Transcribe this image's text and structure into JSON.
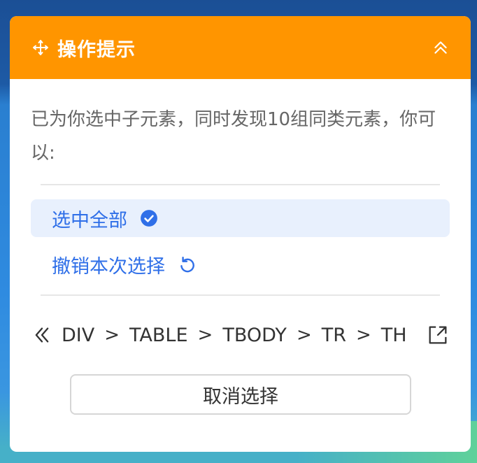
{
  "colors": {
    "accent": "#ff9500",
    "link": "#2f6fe8",
    "selected_bg": "#e8f0fd"
  },
  "header": {
    "title": "操作提示",
    "move_icon": "move-icon",
    "collapse_icon": "chevron-double-up-icon"
  },
  "tip": {
    "text": "已为你选中子元素，同时发现10组同类元素，你可以:"
  },
  "options": [
    {
      "label": "选中全部",
      "icon": "check-circle-icon",
      "selected": true
    },
    {
      "label": "撤销本次选择",
      "icon": "undo-icon",
      "selected": false
    }
  ],
  "path": {
    "items": [
      "DIV",
      "TABLE",
      "TBODY",
      "TR",
      "TH"
    ],
    "separator": ">",
    "back_icon": "chevron-double-left-icon",
    "external_icon": "external-link-icon"
  },
  "cancel_button": {
    "label": "取消选择"
  }
}
